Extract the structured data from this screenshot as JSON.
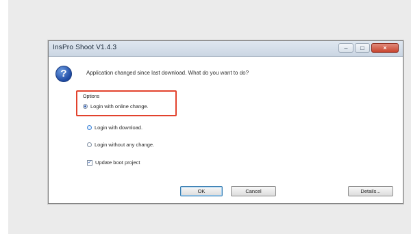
{
  "window": {
    "title": "InsPro Shoot V1.4.3",
    "controls": [
      "–",
      "□",
      "×"
    ]
  },
  "dialog": {
    "message": "Application changed since last download. What do you want to do?",
    "options_title": "Options",
    "options": [
      {
        "label": "Login with online change.",
        "selected": true
      },
      {
        "label": "Login with download.",
        "selected": false
      },
      {
        "label": "Login without any change.",
        "selected": false
      }
    ],
    "checkbox_label": "Update boot project",
    "checkbox_checked": true,
    "buttons": {
      "ok": "OK",
      "cancel": "Cancel",
      "details": "Details..."
    }
  },
  "icons": {
    "question": "question-icon",
    "checkmark": "✓"
  },
  "colors": {
    "highlight_border": "#e2422d",
    "title_bar": "#cbd6e3",
    "close_button": "#c9452f",
    "question_icon": "#1e4aa3"
  }
}
